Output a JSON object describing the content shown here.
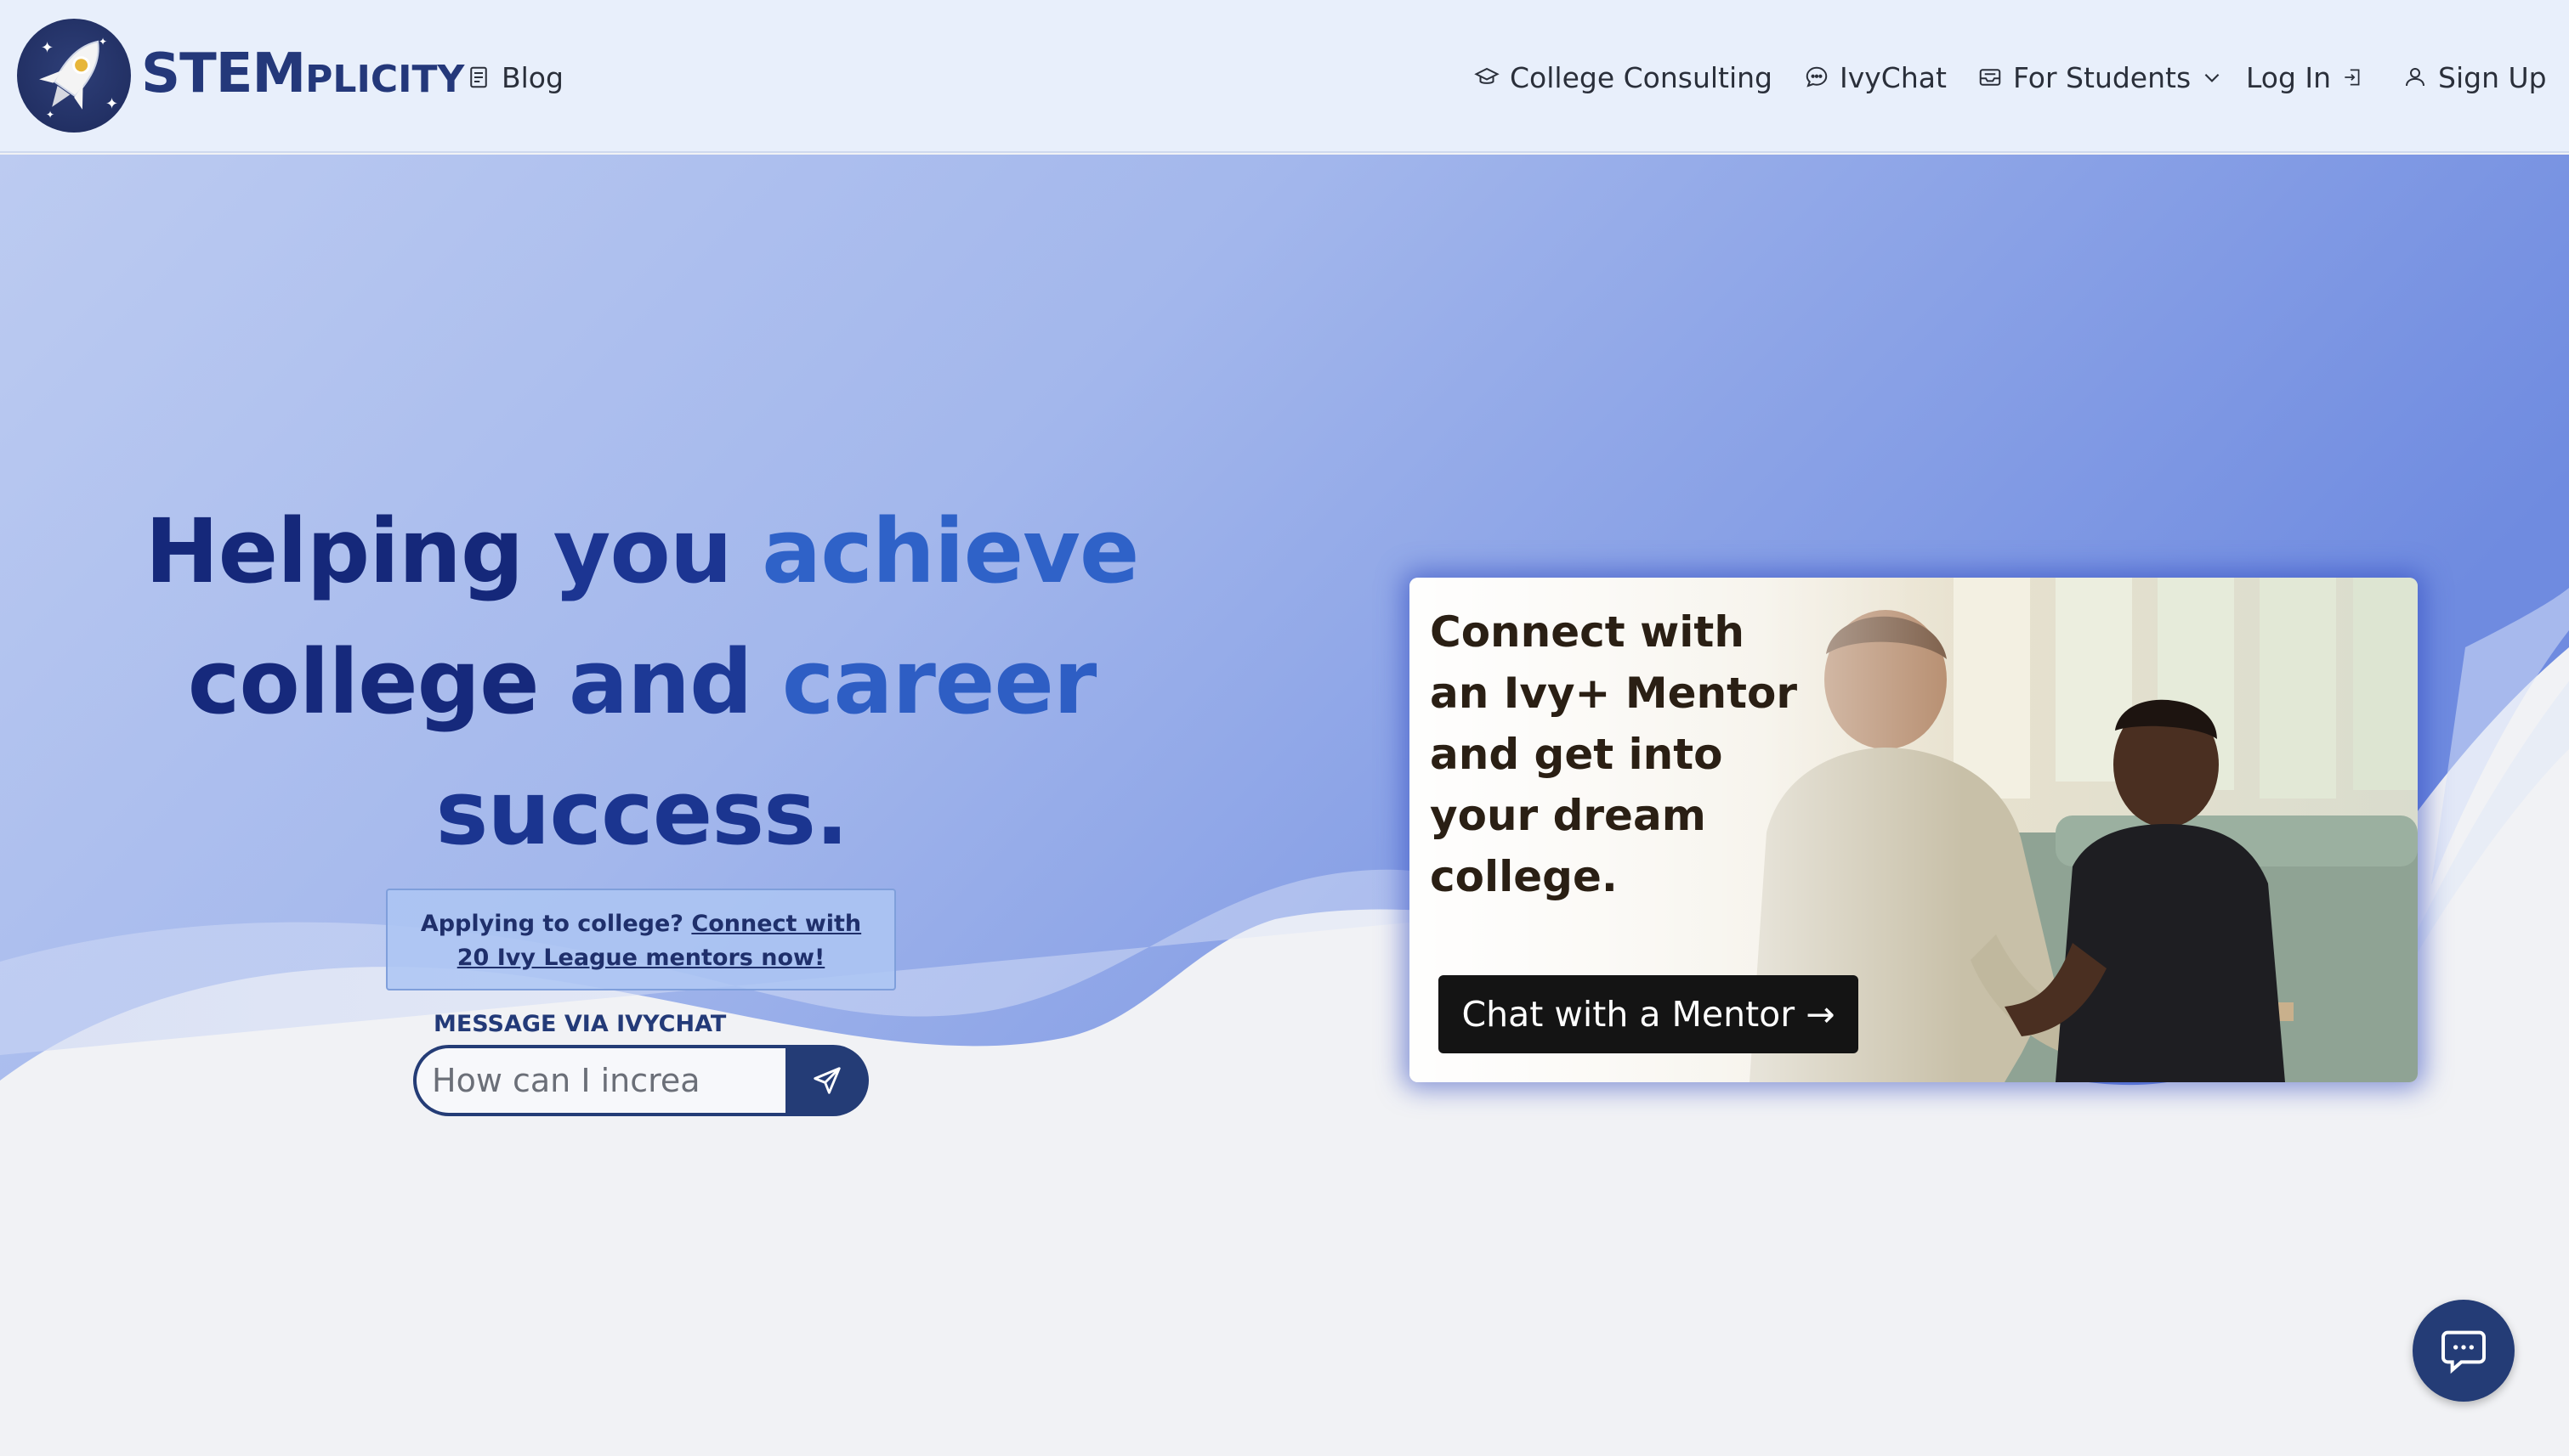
{
  "brand": {
    "main": "STEM",
    "suffix": "PLICITY"
  },
  "nav": {
    "blog": "Blog",
    "college_consulting": "College Consulting",
    "ivychat": "IvyChat",
    "for_students": "For Students",
    "log_in": "Log In",
    "sign_up": "Sign Up"
  },
  "hero": {
    "headline_words": [
      "Helping",
      "you",
      "achieve",
      "college",
      "and",
      "career",
      "success."
    ],
    "headline_colors": [
      "#15287a",
      "#1c3592",
      "#2f62c8",
      "#16297c",
      "#1d3996",
      "#2e5ec4",
      "#1b3590"
    ],
    "promo_prefix": "Applying to college?",
    "promo_link": "Connect with 20 Ivy League mentors now!",
    "message_label": "MESSAGE VIA IVYCHAT",
    "message_placeholder": "How can I increa"
  },
  "card": {
    "text": "Connect with an Ivy+ Mentor and get into your dream college.",
    "cta": "Chat with a Mentor →"
  },
  "colors": {
    "navy": "#243c76",
    "nav_bg": "#e8effb",
    "gold": "#e7b63a"
  },
  "icons": [
    "rocket-logo-icon",
    "document-icon",
    "graduation-cap-icon",
    "chat-bubble-icon",
    "inbox-icon",
    "chevron-down-icon",
    "login-icon",
    "user-icon",
    "send-icon",
    "chat-fab-icon"
  ]
}
